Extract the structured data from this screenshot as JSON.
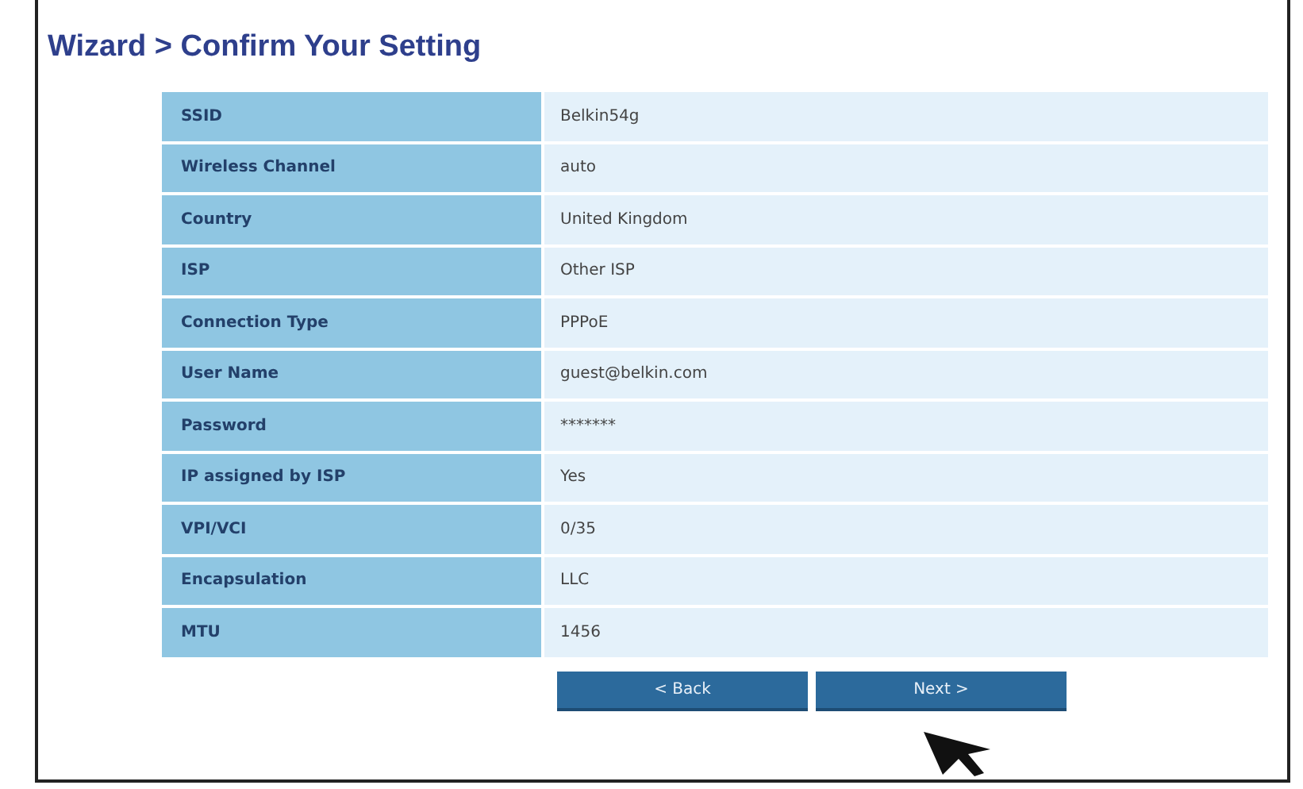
{
  "title": "Wizard > Confirm Your Setting",
  "rows": [
    {
      "label": "SSID",
      "value": "Belkin54g"
    },
    {
      "label": "Wireless Channel",
      "value": "auto"
    },
    {
      "label": "Country",
      "value": "United Kingdom"
    },
    {
      "label": "ISP",
      "value": "Other ISP"
    },
    {
      "label": "Connection Type",
      "value": "PPPoE"
    },
    {
      "label": "User Name",
      "value": "guest@belkin.com"
    },
    {
      "label": "Password",
      "value": "*******"
    },
    {
      "label": "IP assigned by ISP",
      "value": "Yes"
    },
    {
      "label": "VPI/VCI",
      "value": "0/35"
    },
    {
      "label": "Encapsulation",
      "value": "LLC"
    },
    {
      "label": "MTU",
      "value": "1456"
    }
  ],
  "buttons": [
    "< Back",
    "Next >"
  ]
}
